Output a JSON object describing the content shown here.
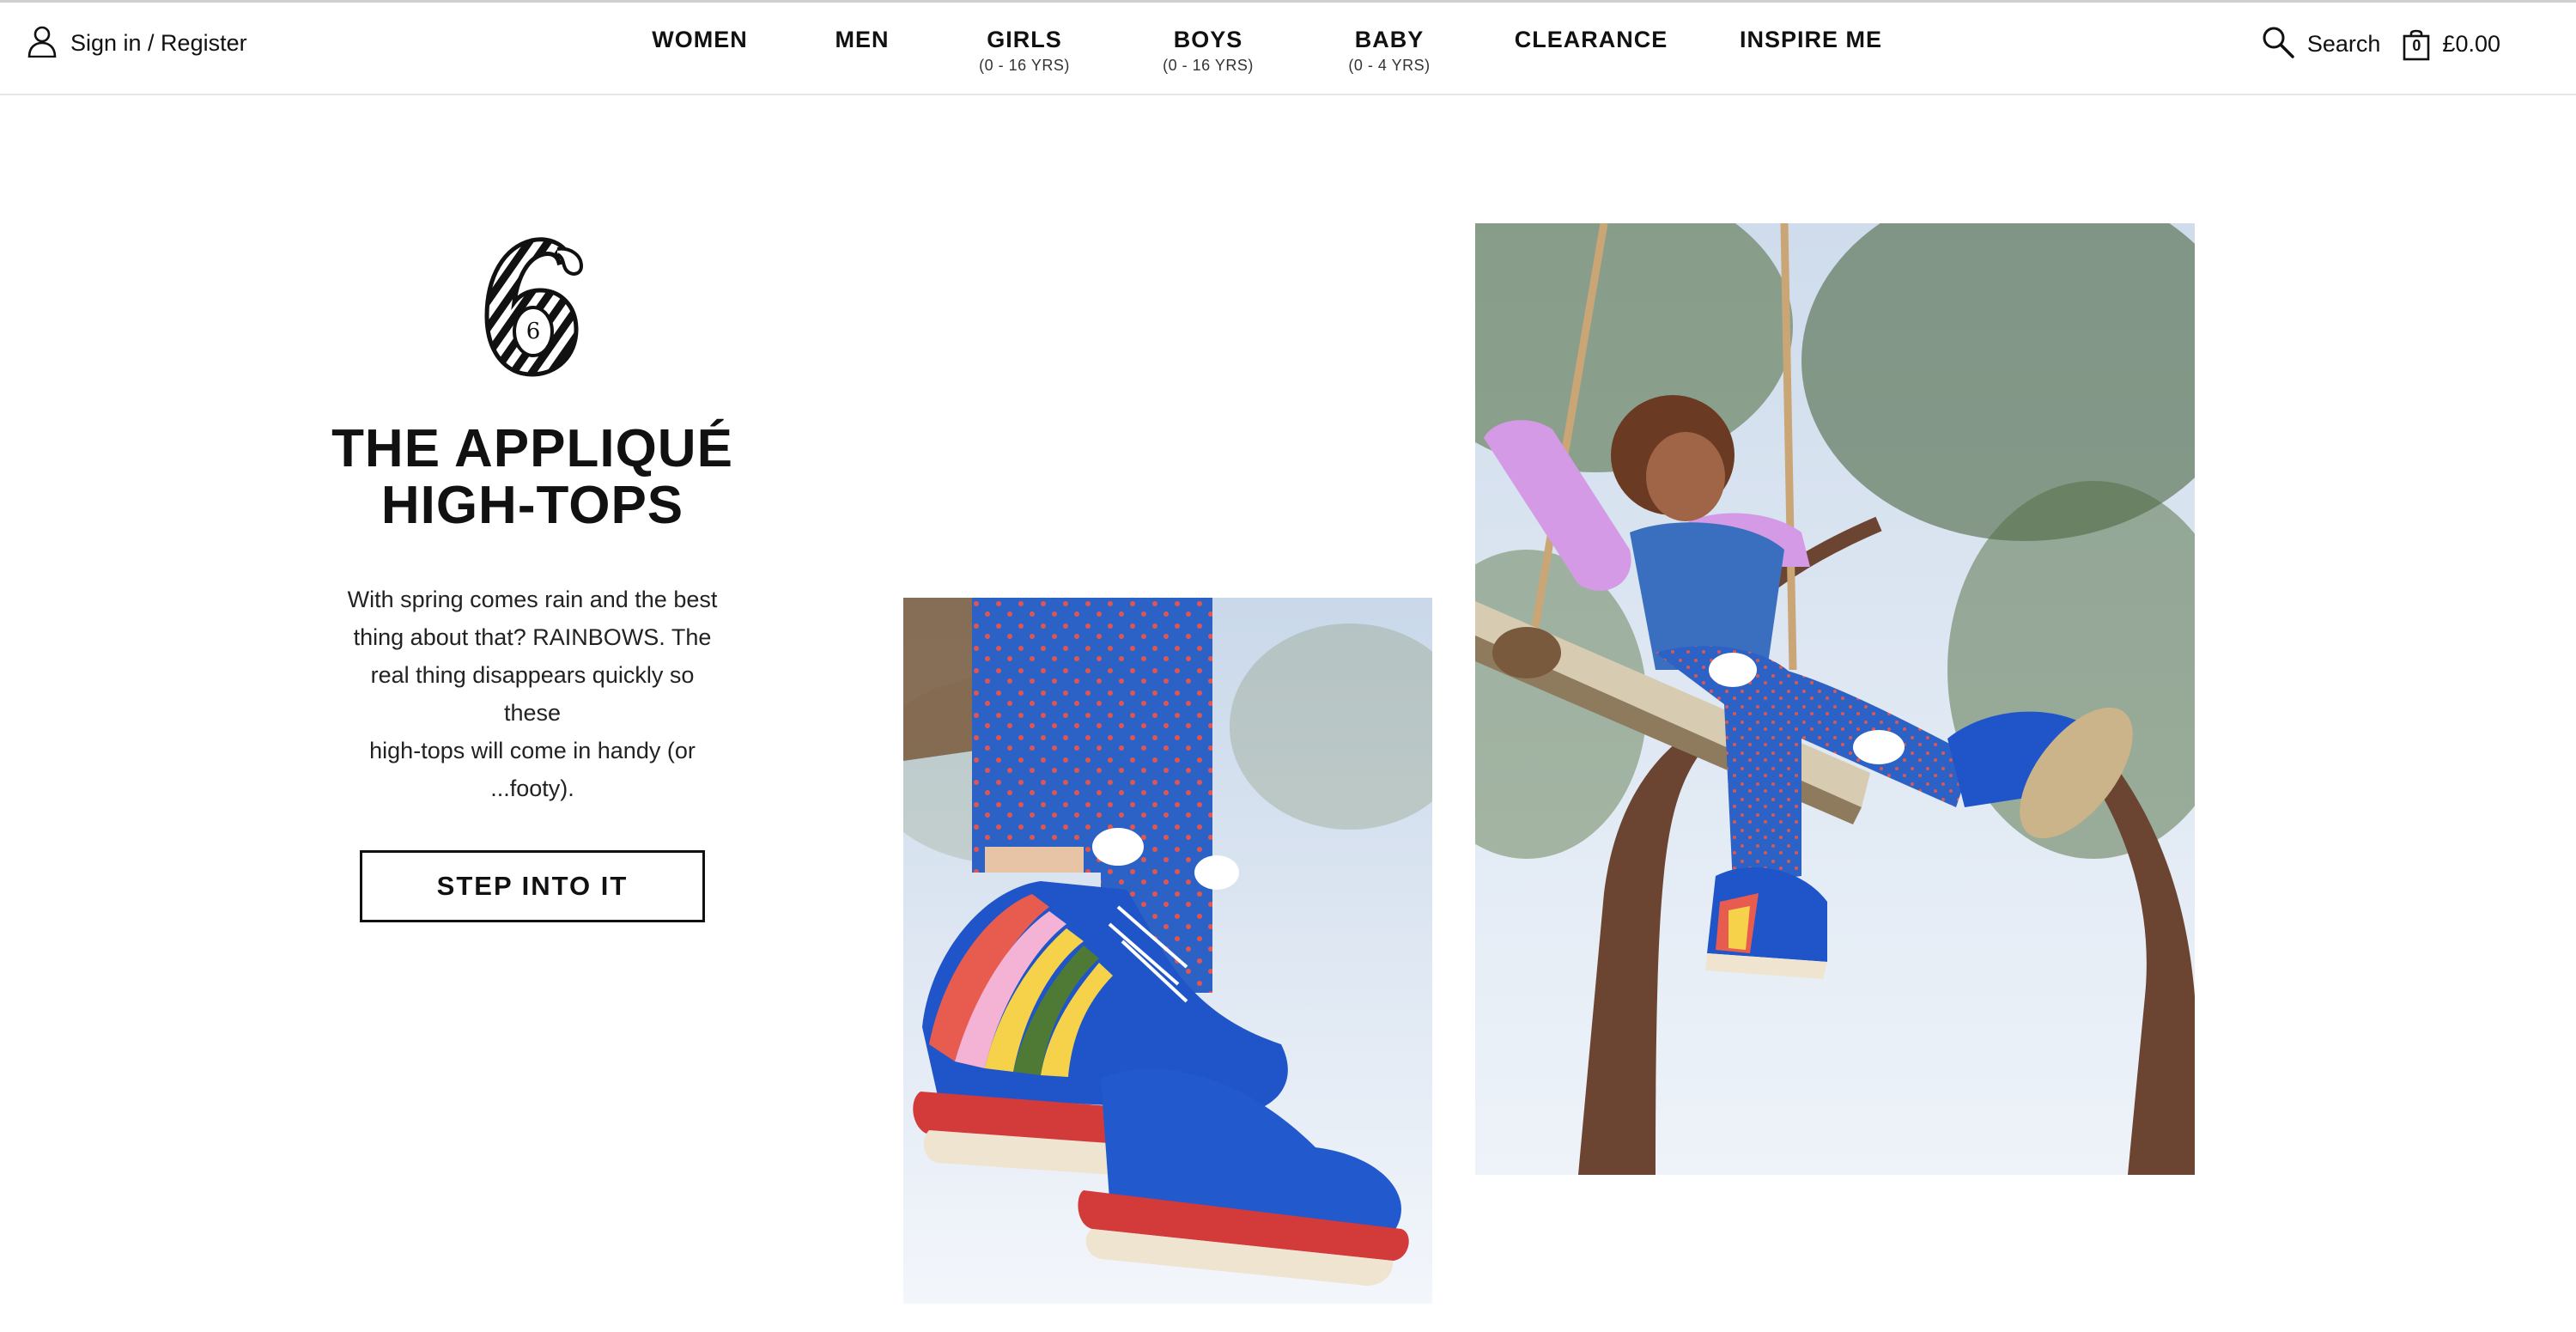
{
  "header": {
    "signin_label": "Sign in / Register",
    "nav": [
      {
        "label": "WOMEN",
        "sub": ""
      },
      {
        "label": "MEN",
        "sub": ""
      },
      {
        "label": "GIRLS",
        "sub": "(0 - 16 YRS)"
      },
      {
        "label": "BOYS",
        "sub": "(0 - 16 YRS)"
      },
      {
        "label": "BABY",
        "sub": "(0 - 4 YRS)"
      },
      {
        "label": "CLEARANCE",
        "sub": ""
      },
      {
        "label": "INSPIRE ME",
        "sub": ""
      }
    ],
    "search_label": "Search",
    "cart_count": "0",
    "cart_total": "£0.00"
  },
  "feature": {
    "number": "6",
    "title_line1": "THE APPLIQUÉ",
    "title_line2": "HIGH-TOPS",
    "body_lines": [
      "With spring comes rain and the best",
      "thing about that? RAINBOWS. The",
      "real thing disappears quickly so these",
      "high-tops will come in handy (or",
      "...footy)."
    ],
    "cta_label": "STEP INTO IT"
  },
  "colors": {
    "sky": "#dfe9f5",
    "leggings_blue": "#2c62c6",
    "shoe_blue": "#1f55c8",
    "top_pink": "#d49ae6",
    "trunk_brown": "#6b4432"
  }
}
